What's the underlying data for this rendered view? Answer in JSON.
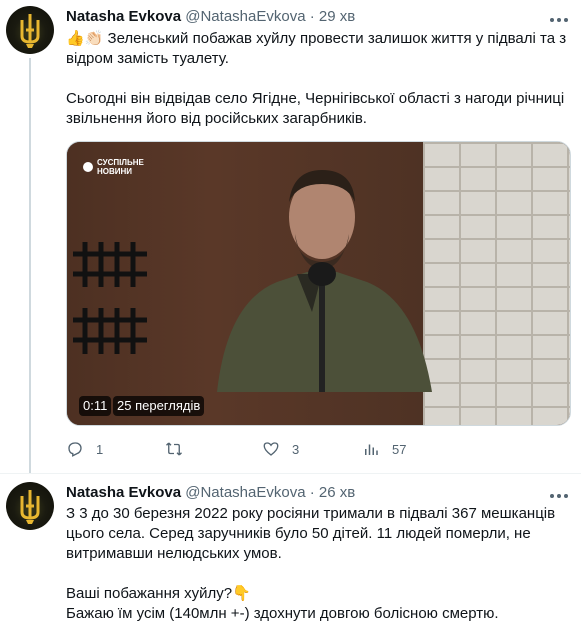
{
  "tweets": [
    {
      "author_name": "Natasha Evkova",
      "handle": "@NatashaEvkova",
      "separator": "·",
      "time": "29 хв",
      "lines": [
        "👍👏🏻 Зеленський побажав хуйлу провести залишок життя у підвалі та з",
        "відром замість туалету.",
        "",
        "Сьогодні він відвідав село Ягідне, Чернігівської області з нагоди річниці",
        "звільнення його від російських загарбників."
      ],
      "media": {
        "brand_line1": "СУСПІЛЬНЕ",
        "brand_line2": "НОВИНИ",
        "duration": "0:11",
        "views": "25 переглядів"
      },
      "actions": {
        "reply_count": "1",
        "retweet_count": "",
        "like_count": "3",
        "views_count": "57"
      }
    },
    {
      "author_name": "Natasha Evkova",
      "handle": "@NatashaEvkova",
      "separator": "·",
      "time": "26 хв",
      "lines": [
        "З 3 до 30 березня 2022 року росіяни тримали в підвалі 367 мешканців",
        "цього села. Серед заручників було 50 дітей. 11 людей померли, не",
        "витримавши нелюдських умов.",
        "",
        "Ваші побажання хуйлу?👇",
        "Бажаю їм усім (140млн +-) здохнути довгою болісною смертю."
      ]
    }
  ],
  "icons": {
    "more": "more-horizontal-icon",
    "reply": "reply-icon",
    "retweet": "retweet-icon",
    "like": "heart-icon",
    "views": "analytics-icon"
  },
  "colors": {
    "text": "#0f1419",
    "secondary": "#536471",
    "divider": "#eff3f4"
  }
}
